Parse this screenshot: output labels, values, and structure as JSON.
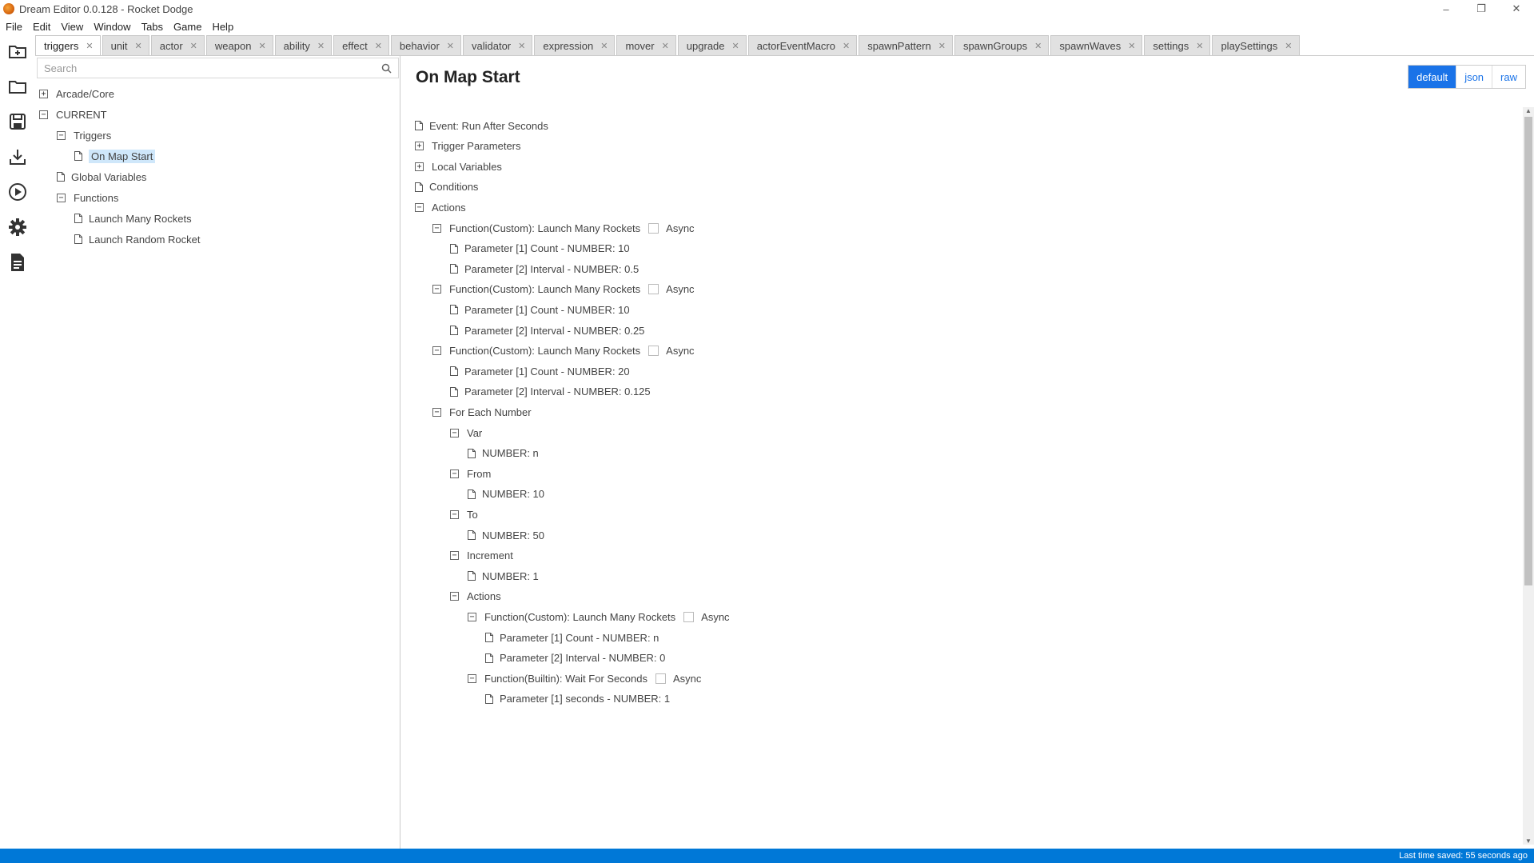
{
  "window": {
    "title": "Dream Editor 0.0.128 - Rocket Dodge",
    "minimize": "–",
    "restore": "❐",
    "close": "✕"
  },
  "menu": [
    "File",
    "Edit",
    "View",
    "Window",
    "Tabs",
    "Game",
    "Help"
  ],
  "tabs": [
    "triggers",
    "unit",
    "actor",
    "weapon",
    "ability",
    "effect",
    "behavior",
    "validator",
    "expression",
    "mover",
    "upgrade",
    "actorEventMacro",
    "spawnPattern",
    "spawnGroups",
    "spawnWaves",
    "settings",
    "playSettings"
  ],
  "tab_close": "✕",
  "left": {
    "search_placeholder": "Search",
    "tree": [
      {
        "label": "Arcade/Core",
        "kind": "plus"
      },
      {
        "label": "CURRENT",
        "kind": "minus"
      },
      {
        "label": "Triggers",
        "kind": "minus"
      },
      {
        "label": "On Map Start",
        "kind": "doc"
      },
      {
        "label": "Global Variables",
        "kind": "doc"
      },
      {
        "label": "Functions",
        "kind": "minus"
      },
      {
        "label": "Launch Many Rockets",
        "kind": "doc"
      },
      {
        "label": "Launch Random Rocket",
        "kind": "doc"
      }
    ]
  },
  "main": {
    "title": "On Map Start",
    "view_buttons": [
      "default",
      "json",
      "raw"
    ],
    "async_label": "Async",
    "tree": [
      {
        "label": "Event: Run After Seconds",
        "kind": "doc"
      },
      {
        "label": "Trigger Parameters",
        "kind": "plus"
      },
      {
        "label": "Local Variables",
        "kind": "plus"
      },
      {
        "label": "Conditions",
        "kind": "doc"
      },
      {
        "label": "Actions",
        "kind": "minus"
      },
      {
        "label": "Function(Custom): Launch Many Rockets",
        "kind": "minus"
      },
      {
        "label": "Parameter [1] Count - NUMBER: 10",
        "kind": "doc"
      },
      {
        "label": "Parameter [2] Interval - NUMBER: 0.5",
        "kind": "doc"
      },
      {
        "label": "Function(Custom): Launch Many Rockets",
        "kind": "minus"
      },
      {
        "label": "Parameter [1] Count - NUMBER: 10",
        "kind": "doc"
      },
      {
        "label": "Parameter [2] Interval - NUMBER: 0.25",
        "kind": "doc"
      },
      {
        "label": "Function(Custom): Launch Many Rockets",
        "kind": "minus"
      },
      {
        "label": "Parameter [1] Count - NUMBER: 20",
        "kind": "doc"
      },
      {
        "label": "Parameter [2] Interval - NUMBER: 0.125",
        "kind": "doc"
      },
      {
        "label": "For Each Number",
        "kind": "minus"
      },
      {
        "label": "Var",
        "kind": "minus"
      },
      {
        "label": "NUMBER: n",
        "kind": "doc"
      },
      {
        "label": "From",
        "kind": "minus"
      },
      {
        "label": "NUMBER: 10",
        "kind": "doc"
      },
      {
        "label": "To",
        "kind": "minus"
      },
      {
        "label": "NUMBER: 50",
        "kind": "doc"
      },
      {
        "label": "Increment",
        "kind": "minus"
      },
      {
        "label": "NUMBER: 1",
        "kind": "doc"
      },
      {
        "label": "Actions",
        "kind": "minus"
      },
      {
        "label": "Function(Custom): Launch Many Rockets",
        "kind": "minus"
      },
      {
        "label": "Parameter [1] Count - NUMBER: n",
        "kind": "doc"
      },
      {
        "label": "Parameter [2] Interval - NUMBER: 0",
        "kind": "doc"
      },
      {
        "label": "Function(Builtin): Wait For Seconds",
        "kind": "minus"
      },
      {
        "label": "Parameter [1] seconds - NUMBER: 1",
        "kind": "doc"
      }
    ]
  },
  "status": {
    "text": "Last time saved: 55 seconds ago"
  },
  "colors": {
    "accent": "#1a73e8",
    "status_bar": "#0078d7",
    "selection": "#cfe7fa"
  }
}
